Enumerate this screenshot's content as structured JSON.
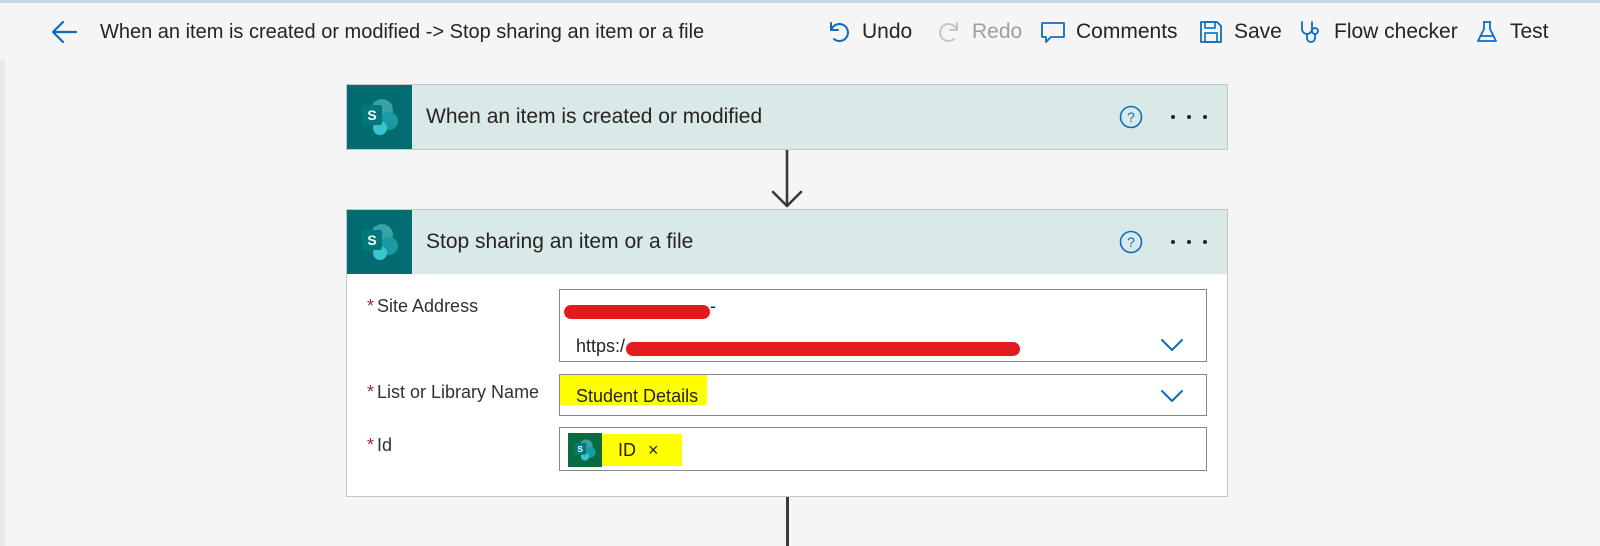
{
  "header": {
    "title": "When an item is created or modified -> Stop sharing an item or a file",
    "back_icon": "arrow-left-icon",
    "toolbar": {
      "undo_label": "Undo",
      "redo_label": "Redo",
      "comments_label": "Comments",
      "save_label": "Save",
      "flow_checker_label": "Flow checker",
      "test_label": "Test"
    }
  },
  "trigger_card": {
    "title": "When an item is created or modified",
    "icon": "sharepoint-icon"
  },
  "action_card": {
    "title": "Stop sharing an item or a file",
    "icon": "sharepoint-icon",
    "fields": {
      "site_address": {
        "label": "Site Address",
        "required_mark": "*",
        "value_line1_suffix": "-",
        "value_line2_prefix": "https:/"
      },
      "list_name": {
        "label": "List or Library Name",
        "required_mark": "*",
        "value": "Student Details"
      },
      "id": {
        "label": "Id",
        "required_mark": "*",
        "token_text": "ID",
        "token_close": "×",
        "token_icon": "sharepoint-icon"
      }
    }
  },
  "colors": {
    "accent": "#0f6cbd",
    "card_header_bg": "#d9e9e8",
    "sharepoint_teal": "#036c70",
    "redaction": "#e21c1c",
    "highlight": "#ffff00",
    "required": "#a4262c"
  }
}
